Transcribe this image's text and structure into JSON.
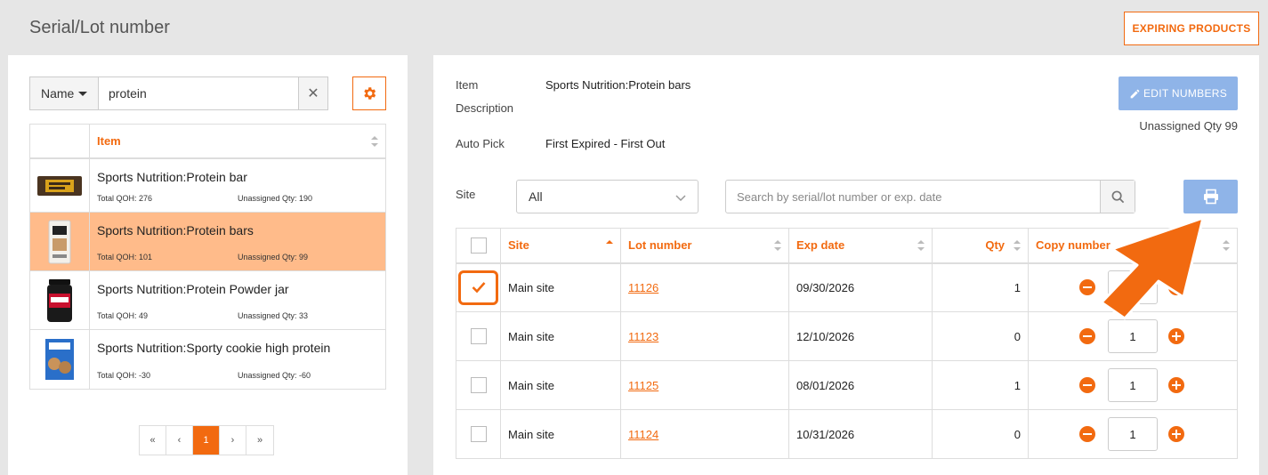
{
  "page": {
    "title": "Serial/Lot number",
    "expiring_button": "EXPIRING PRODUCTS"
  },
  "left": {
    "search_field": "Name",
    "search_value": "protein",
    "clear_icon": "close-icon",
    "settings_icon": "gear-icon",
    "table_header": "Item",
    "items": [
      {
        "name": "Sports Nutrition:Protein bar",
        "qoh": "Total QOH: 276",
        "unassigned": "Unassigned Qty: 190"
      },
      {
        "name": "Sports Nutrition:Protein bars",
        "qoh": "Total QOH: 101",
        "unassigned": "Unassigned Qty: 99",
        "selected": true
      },
      {
        "name": "Sports Nutrition:Protein Powder jar",
        "qoh": "Total QOH: 49",
        "unassigned": "Unassigned Qty: 33"
      },
      {
        "name": "Sports Nutrition:Sporty cookie high protein",
        "qoh": "Total QOH: -30",
        "unassigned": "Unassigned Qty: -60"
      }
    ],
    "pager": {
      "first": "«",
      "prev": "‹",
      "current": "1",
      "next": "›",
      "last": "»"
    }
  },
  "details": {
    "item_label": "Item",
    "description_label": "Description",
    "item_value": "Sports Nutrition:Protein bars",
    "autopick_label": "Auto Pick",
    "autopick_value": "First Expired - First Out",
    "edit_button": "EDIT NUMBERS",
    "unassigned": "Unassigned Qty 99",
    "site_label": "Site",
    "site_value": "All",
    "search_placeholder": "Search by serial/lot number or exp. date"
  },
  "lots": {
    "headers": {
      "site": "Site",
      "lot": "Lot number",
      "exp": "Exp date",
      "qty": "Qty",
      "copy": "Copy number"
    },
    "rows": [
      {
        "checked": true,
        "site": "Main site",
        "lot": "11126",
        "exp": "09/30/2026",
        "qty": "1",
        "copies": "1"
      },
      {
        "checked": false,
        "site": "Main site",
        "lot": "11123",
        "exp": "12/10/2026",
        "qty": "0",
        "copies": "1"
      },
      {
        "checked": false,
        "site": "Main site",
        "lot": "11125",
        "exp": "08/01/2026",
        "qty": "1",
        "copies": "1"
      },
      {
        "checked": false,
        "site": "Main site",
        "lot": "11124",
        "exp": "10/31/2026",
        "qty": "0",
        "copies": "1"
      }
    ]
  },
  "colors": {
    "accent": "#f26a10",
    "selected_row": "#ffbb8a",
    "disabled_button": "#8fb4e8"
  }
}
